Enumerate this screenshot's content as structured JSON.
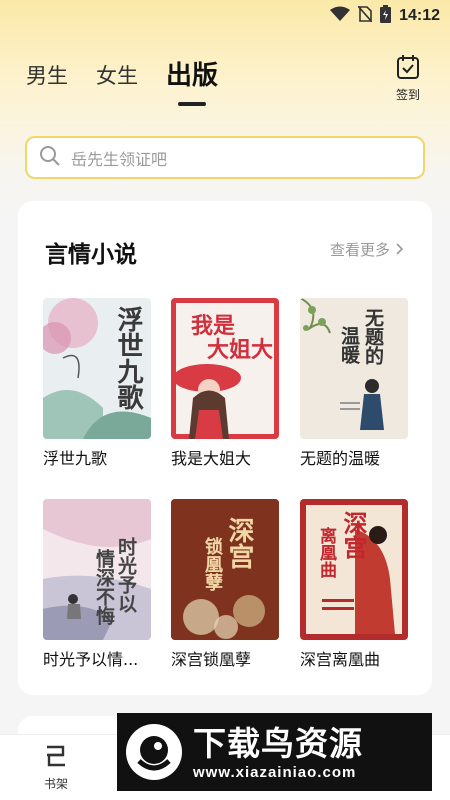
{
  "status_bar": {
    "time": "14:12",
    "icons": [
      "wifi-icon",
      "no-sim-icon",
      "battery-icon"
    ]
  },
  "header": {
    "tabs": [
      {
        "label": "男生",
        "active": false
      },
      {
        "label": "女生",
        "active": false
      },
      {
        "label": "出版",
        "active": true
      }
    ],
    "signin_label": "签到"
  },
  "search": {
    "placeholder": "岳先生领证吧"
  },
  "section": {
    "title": "言情小说",
    "more_label": "查看更多",
    "books": [
      {
        "title": "浮世九歌"
      },
      {
        "title": "我是大姐大"
      },
      {
        "title": "无题的温暖"
      },
      {
        "title": "时光予以情..."
      },
      {
        "title": "深宫锁凰孽"
      },
      {
        "title": "深宫离凰曲"
      }
    ]
  },
  "bottom_nav": {
    "items": [
      {
        "label": "书架",
        "icon": "bookshelf-icon"
      }
    ]
  },
  "watermark": {
    "title": "下载鸟资源",
    "url": "www.xiazainiao.com"
  },
  "colors": {
    "accent": "#f3d66a",
    "header_bg": "#fbe9a8",
    "text_primary": "#111111",
    "text_muted": "#999999"
  }
}
